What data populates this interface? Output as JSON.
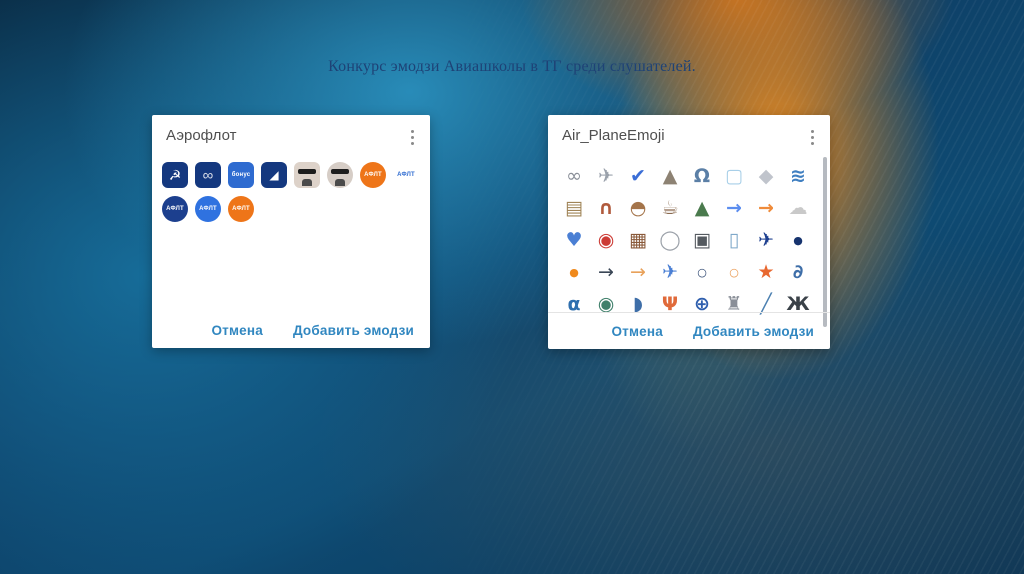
{
  "slide": {
    "title": "Конкурс эмодзи Авиашколы в ТГ среди слушателей."
  },
  "colors": {
    "button_blue": "#3187c0",
    "dialog_title_gray": "#4f4f4f",
    "slide_title_navy": "#1e4276",
    "aeroflot_navy": "#14387f",
    "bonus_blue": "#2e6bd0",
    "aflt_orange": "#ee7519",
    "aflt_bright_blue": "#2f72e0",
    "background_orange": "#f28c1a",
    "background_cyan": "#2c96c4"
  },
  "dialog_left": {
    "title": "Аэрофлот",
    "menu_icon": "kebab-menu",
    "footer": {
      "cancel": "Отмена",
      "add": "Добавить эмодзи"
    },
    "stickers": [
      {
        "name": "aeroflot-wings-badge",
        "shape": "square",
        "bg": "#14387f",
        "glyph": "☭",
        "fg": "#ffffff",
        "glyph_size": 14
      },
      {
        "name": "swirl-logo-badge",
        "shape": "square",
        "bg": "#14387f",
        "glyph": "∞",
        "fg": "#d9dde8",
        "glyph_size": 15
      },
      {
        "name": "bonus-badge",
        "shape": "square",
        "bg": "#2e6bd0",
        "text": "бонус",
        "fg": "#ffffff"
      },
      {
        "name": "wing-badge",
        "shape": "square",
        "bg": "#14387f",
        "glyph": "◢",
        "fg": "#ffffff",
        "glyph_size": 12
      },
      {
        "name": "person-photo-square",
        "shape": "square",
        "type": "face",
        "bg": "#ddd2c9"
      },
      {
        "name": "person-photo-round",
        "shape": "circle",
        "type": "face",
        "bg": "#d6cdc6"
      },
      {
        "name": "aflt-orange-badge-1",
        "shape": "circle",
        "bg": "#ee7519",
        "text": "АФЛТ",
        "fg": "#ffffff"
      },
      {
        "name": "aflt-light-logo",
        "shape": "plain",
        "text": "АФЛТ",
        "fg": "#2e6bd0"
      },
      {
        "name": "aflt-navy-badge",
        "shape": "circle",
        "bg": "#1c3f8e",
        "text": "АФЛТ",
        "fg": "#ffffff"
      },
      {
        "name": "aflt-blue-badge",
        "shape": "circle",
        "bg": "#2f72e0",
        "text": "АФЛТ",
        "fg": "#ffffff"
      },
      {
        "name": "aflt-orange-badge-2",
        "shape": "circle",
        "bg": "#ee7519",
        "text": "АФЛТ",
        "fg": "#ffffff"
      }
    ]
  },
  "dialog_right": {
    "title": "Air_PlaneEmoji",
    "menu_icon": "kebab-menu",
    "footer": {
      "cancel": "Отмена",
      "add": "Добавить эмодзи"
    },
    "emoji": [
      {
        "name": "knot",
        "glyph": "∞",
        "color": "#8a8f98"
      },
      {
        "name": "plane-sculpture",
        "glyph": "✈",
        "color": "#9aa1ab"
      },
      {
        "name": "check-mark",
        "glyph": "✔",
        "color": "#3b6ed6"
      },
      {
        "name": "mountain",
        "glyph": "▲",
        "color": "#8d8273"
      },
      {
        "name": "headphones",
        "glyph": "Ω",
        "color": "#5b7fa6",
        "bold": true
      },
      {
        "name": "ice-cube",
        "glyph": "▢",
        "color": "#a8cfe8",
        "bold": true
      },
      {
        "name": "pillow",
        "glyph": "◆",
        "color": "#c0c4cc"
      },
      {
        "name": "wave",
        "glyph": "≋",
        "color": "#3f7fc1",
        "bold": true
      },
      {
        "name": "books",
        "glyph": "▤",
        "color": "#a08457"
      },
      {
        "name": "sausage",
        "glyph": "∩",
        "color": "#b05a3c",
        "bold": true
      },
      {
        "name": "food-bowl",
        "glyph": "◓",
        "color": "#a4744a"
      },
      {
        "name": "coffee",
        "glyph": "☕",
        "color": "#8a6a4f"
      },
      {
        "name": "pine-tree",
        "glyph": "▲",
        "color": "#4a7a4d"
      },
      {
        "name": "arrow-right-blue",
        "glyph": "→",
        "color": "#5b8def",
        "bold": true
      },
      {
        "name": "arrow-right-orange",
        "glyph": "→",
        "color": "#ef8b3a",
        "bold": true
      },
      {
        "name": "shell-white",
        "glyph": "☁",
        "color": "#c9c9c9"
      },
      {
        "name": "blue-heart",
        "glyph": "♥",
        "color": "#4a7fd4"
      },
      {
        "name": "lantern",
        "glyph": "◉",
        "color": "#cc3b35"
      },
      {
        "name": "suitcase",
        "glyph": "▦",
        "color": "#8a5a3a"
      },
      {
        "name": "plane-window",
        "glyph": "◯",
        "color": "#9aa0a8"
      },
      {
        "name": "camera",
        "glyph": "▣",
        "color": "#555a60"
      },
      {
        "name": "smartphone",
        "glyph": "▯",
        "color": "#7fa8c9",
        "bold": true
      },
      {
        "name": "airplane-blue",
        "glyph": "✈",
        "color": "#1d3f8f"
      },
      {
        "name": "dot-blue",
        "glyph": "●",
        "color": "#16336e",
        "size": 11
      },
      {
        "name": "dot-orange",
        "glyph": "●",
        "color": "#f08a1d",
        "size": 11
      },
      {
        "name": "arrow-right-dark",
        "glyph": "→",
        "color": "#3a4656"
      },
      {
        "name": "arrow-thin-orange",
        "glyph": "→",
        "color": "#e8a15a"
      },
      {
        "name": "airplane-outline",
        "glyph": "✈",
        "color": "#4a7fd4"
      },
      {
        "name": "ring-dark",
        "glyph": "○",
        "color": "#27406b",
        "size": 11,
        "bold": true
      },
      {
        "name": "ring-orange",
        "glyph": "○",
        "color": "#e8954a",
        "size": 11,
        "bold": true
      },
      {
        "name": "starfish",
        "glyph": "★",
        "color": "#e86830"
      },
      {
        "name": "spiral-shell",
        "glyph": "∂",
        "color": "#3e6ea8",
        "bold": true
      },
      {
        "name": "fish",
        "glyph": "α",
        "color": "#2f6fae",
        "bold": true
      },
      {
        "name": "turtle",
        "glyph": "◉",
        "color": "#3f7f6a"
      },
      {
        "name": "striped-shell",
        "glyph": "◗",
        "color": "#3e6ea8"
      },
      {
        "name": "coral",
        "glyph": "Ψ",
        "color": "#e06a3a",
        "bold": true
      },
      {
        "name": "globe",
        "glyph": "⊕",
        "color": "#2f5fae",
        "bold": true
      },
      {
        "name": "tower",
        "glyph": "♜",
        "color": "#8a8f98"
      },
      {
        "name": "bandage",
        "glyph": "╱",
        "color": "#4a7fb0",
        "bold": true
      },
      {
        "name": "crab",
        "glyph": "Ж",
        "color": "#3a4148",
        "bold": true
      }
    ]
  }
}
